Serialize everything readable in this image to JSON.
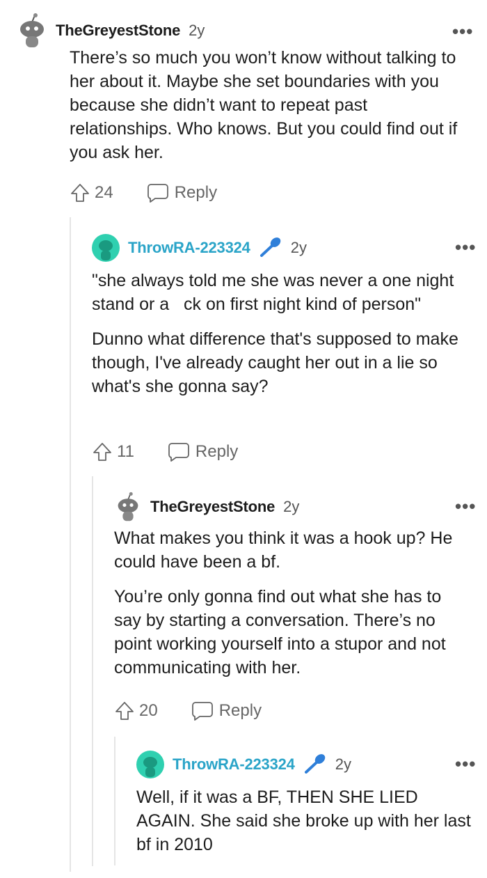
{
  "comments": [
    {
      "username": "TheGreyestStone",
      "time": "2y",
      "paragraphs": [
        "There’s so much you won’t know without talking to her about it. Maybe she set boundaries with you because she didn’t want to repeat past relationships. Who knows. But you could find out if you ask her."
      ],
      "votes": "24",
      "reply_label": "Reply",
      "more": "•••"
    },
    {
      "username": "ThrowRA-223324",
      "time": "2y",
      "paragraphs": [
        "\"she always told me she was never a one night stand or a   ck on first night kind of person\"",
        "Dunno what difference that's supposed to make though, I've already caught her out in a lie so what's she gonna say?"
      ],
      "votes": "11",
      "reply_label": "Reply",
      "more": "•••"
    },
    {
      "username": "TheGreyestStone",
      "time": "2y",
      "paragraphs": [
        "What makes you think it was a hook up? He could have been a bf.",
        "You’re only gonna find out what she has to say by starting a conversation. There’s no point working yourself into a stupor and not communicating with her."
      ],
      "votes": "20",
      "reply_label": "Reply",
      "more": "•••"
    },
    {
      "username": "ThrowRA-223324",
      "time": "2y",
      "paragraphs": [
        "Well, if it was a BF, THEN SHE LIED AGAIN. She said she broke up with her last bf in 2010"
      ],
      "more": "•••"
    }
  ],
  "colors": {
    "op_name": "#2aa4c8",
    "op_avatar": "#2fd0b0",
    "mic": "#2f7fd9"
  }
}
